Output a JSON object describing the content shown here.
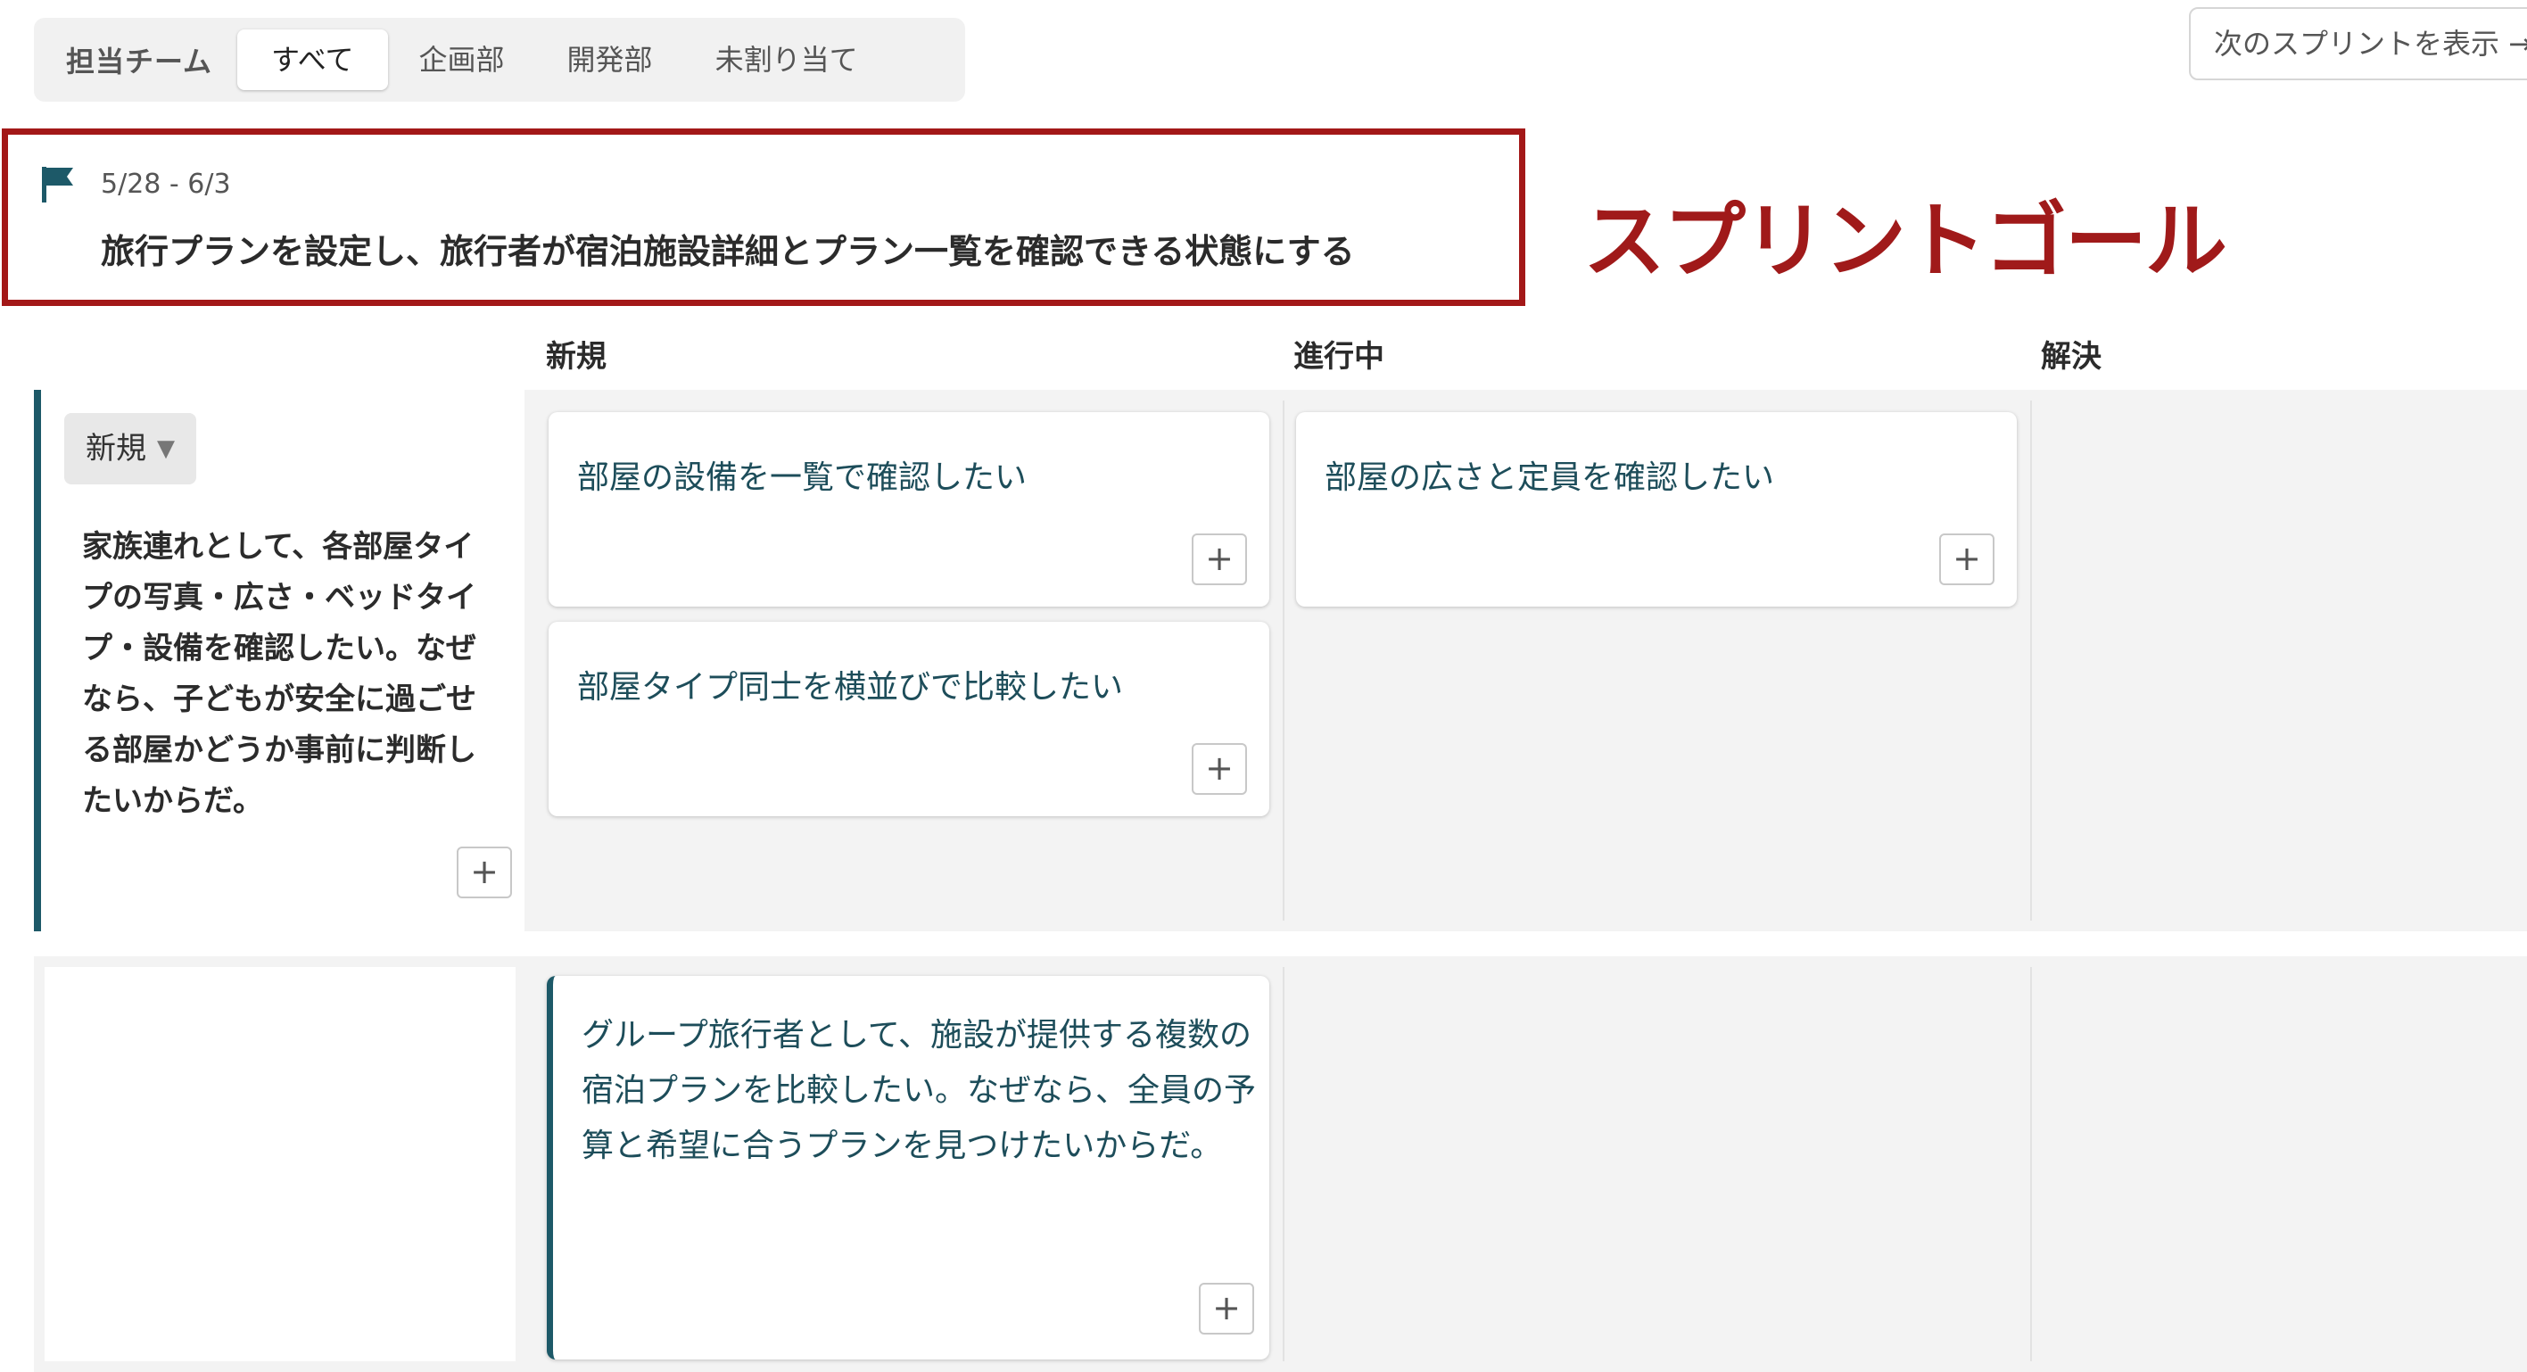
{
  "filter": {
    "label": "担当チーム",
    "tabs": [
      {
        "label": "すべて",
        "active": true
      },
      {
        "label": "企画部"
      },
      {
        "label": "開発部"
      },
      {
        "label": "未割り当て"
      }
    ]
  },
  "next_sprint_button": "次のスプリントを表示 →",
  "sprint_goal": {
    "dates": "5/28 - 6/3",
    "text": "旅行プランを設定し、旅行者が宿泊施設詳細とプラン一覧を確認できる状態にする",
    "annotation": "スプリントゴール"
  },
  "columns": [
    "新規",
    "進行中",
    "解決"
  ],
  "lanes": [
    {
      "status": "新規",
      "story": "家族連れとして、各部屋タイプの写真・広さ・ベッドタイプ・設備を確認したい。なぜなら、子どもが安全に過ごせる部屋かどうか事前に判断したいからだ。",
      "tasks_new": [
        "部屋の設備を一覧で確認したい",
        "部屋タイプ同士を横並びで比較したい"
      ],
      "tasks_in_progress": [
        "部屋の広さと定員を確認したい"
      ]
    },
    {
      "story_card": "グループ旅行者として、施設が提供する複数の宿泊プランを比較したい。なぜなら、全員の予算と希望に合うプランを見つけたいからだ。"
    }
  ],
  "icons": {
    "flag": "flag-icon",
    "plus": "plus-icon",
    "caret": "caret-down-icon"
  },
  "colors": {
    "accent": "#1d5968",
    "annotation": "#a01a1a",
    "card_text": "#1d4d5a"
  }
}
